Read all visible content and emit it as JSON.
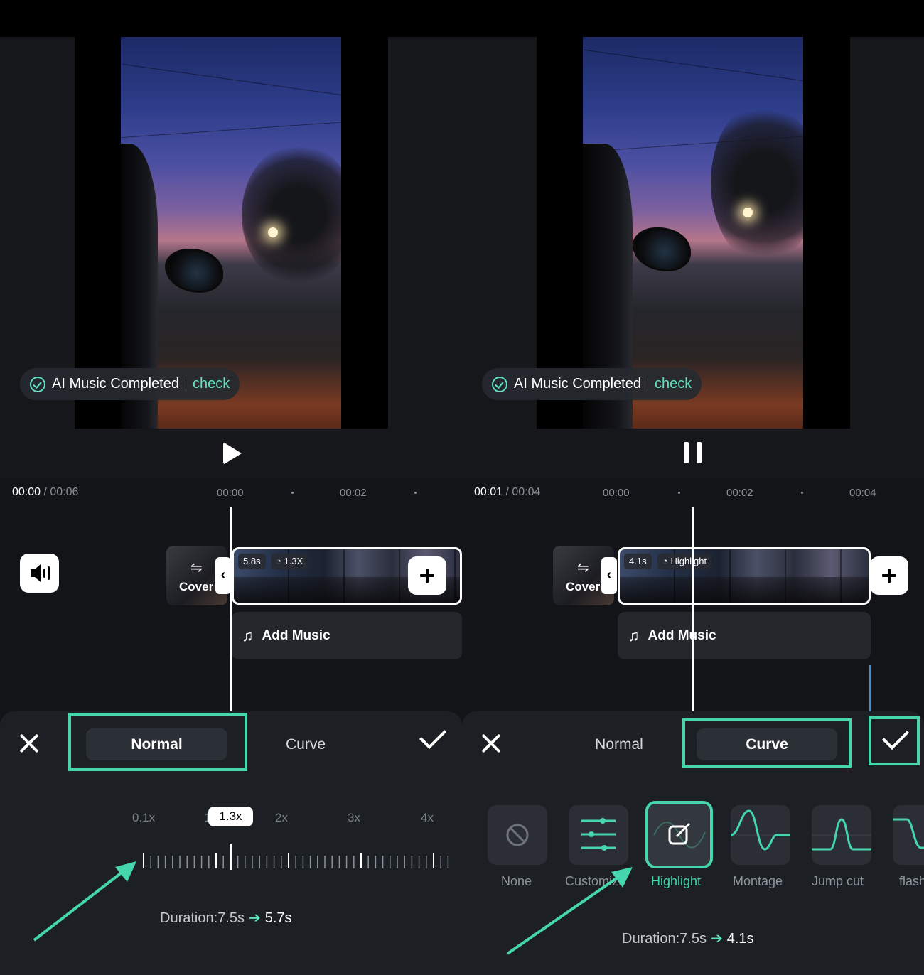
{
  "left": {
    "toast": {
      "text": "AI Music Completed",
      "link": "check"
    },
    "time": {
      "current": "00:00",
      "separator": " / ",
      "total": "00:06"
    },
    "ruler": [
      "00:00",
      "00:02"
    ],
    "cover_label": "Cover",
    "clip": {
      "duration": "5.8s",
      "speed": "1.3X"
    },
    "music_label": "Add Music",
    "tabs": {
      "normal": "Normal",
      "curve": "Curve"
    },
    "speed_marks": [
      "0.1x",
      "1",
      "2x",
      "3x",
      "4x"
    ],
    "speed_value": "1.3x",
    "speed_level": 1.3,
    "duration": {
      "label": "Duration:7.5s",
      "new": "5.7s"
    }
  },
  "right": {
    "toast": {
      "text": "AI Music Completed",
      "link": "check"
    },
    "time": {
      "current": "00:01",
      "separator": " / ",
      "total": "00:04"
    },
    "ruler": [
      "00:00",
      "00:02",
      "00:04"
    ],
    "cover_label": "Cover",
    "clip": {
      "duration": "4.1s",
      "speed": "Highlight"
    },
    "music_label": "Add Music",
    "tabs": {
      "normal": "Normal",
      "curve": "Curve"
    },
    "curves": [
      {
        "label": "None",
        "icon": "none-icon"
      },
      {
        "label": "Customize",
        "icon": "sliders-icon"
      },
      {
        "label": "Highlight",
        "icon": "edit-icon",
        "selected": true
      },
      {
        "label": "Montage",
        "icon": "montage-curve-icon"
      },
      {
        "label": "Jump cut",
        "icon": "jump-cut-curve-icon"
      },
      {
        "label": "flash",
        "icon": "flash-curve-icon"
      }
    ],
    "duration": {
      "label": "Duration:7.5s",
      "new": "4.1s"
    }
  },
  "colors": {
    "accent": "#45d6ae",
    "background": "#121417",
    "sheet": "#1c1f23"
  }
}
